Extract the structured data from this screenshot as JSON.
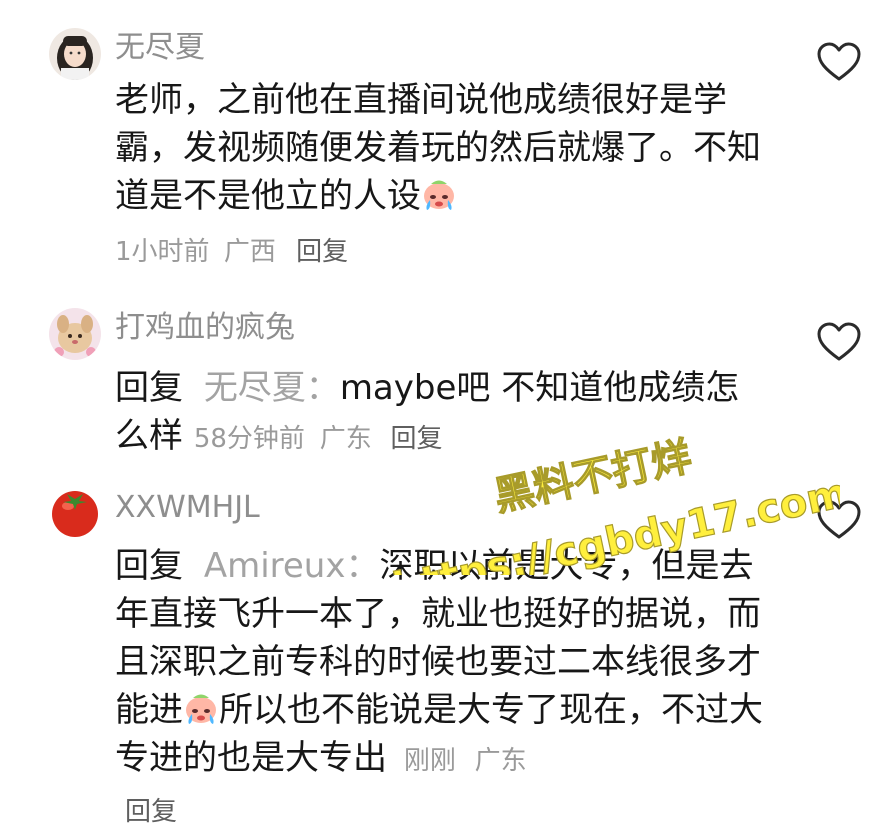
{
  "comments": [
    {
      "username": "无尽夏",
      "text": "老师，之前他在直播间说他成绩很好是学霸，发视频随便发着玩的然后就爆了。不知道是不是他立的人设",
      "emoji": "crying-face-emoji",
      "time": "1小时前",
      "location": "广西",
      "reply_label": "回复"
    },
    {
      "username": "打鸡血的疯兔",
      "reply_prefix": "回复",
      "reply_to": "无尽夏：",
      "text": "maybe吧 不知道他成绩怎么样",
      "time": "58分钟前",
      "location": "广东",
      "reply_label": "回复"
    },
    {
      "username": "XXWMHJL",
      "reply_prefix": "回复",
      "reply_to": "Amireux：",
      "text_before_emoji": "深职以前是大专，但是去年直接飞升一本了，就业也挺好的据说，而且深职之前专科的时候也要过二本线很多才能进",
      "emoji": "crying-face-emoji",
      "text_after_emoji": "所以也不能说是大专了现在，不过大专进的也是大专出",
      "time": "刚刚",
      "location": "广东",
      "reply_label": "回复"
    }
  ],
  "watermark": {
    "line1": "黑料不打烊",
    "line2": "https://cgbdy17.com",
    "color": "#ffef3d"
  },
  "colors": {
    "text": "#171717",
    "meta": "#9a9a9a",
    "heart": "#2b2b2b"
  }
}
